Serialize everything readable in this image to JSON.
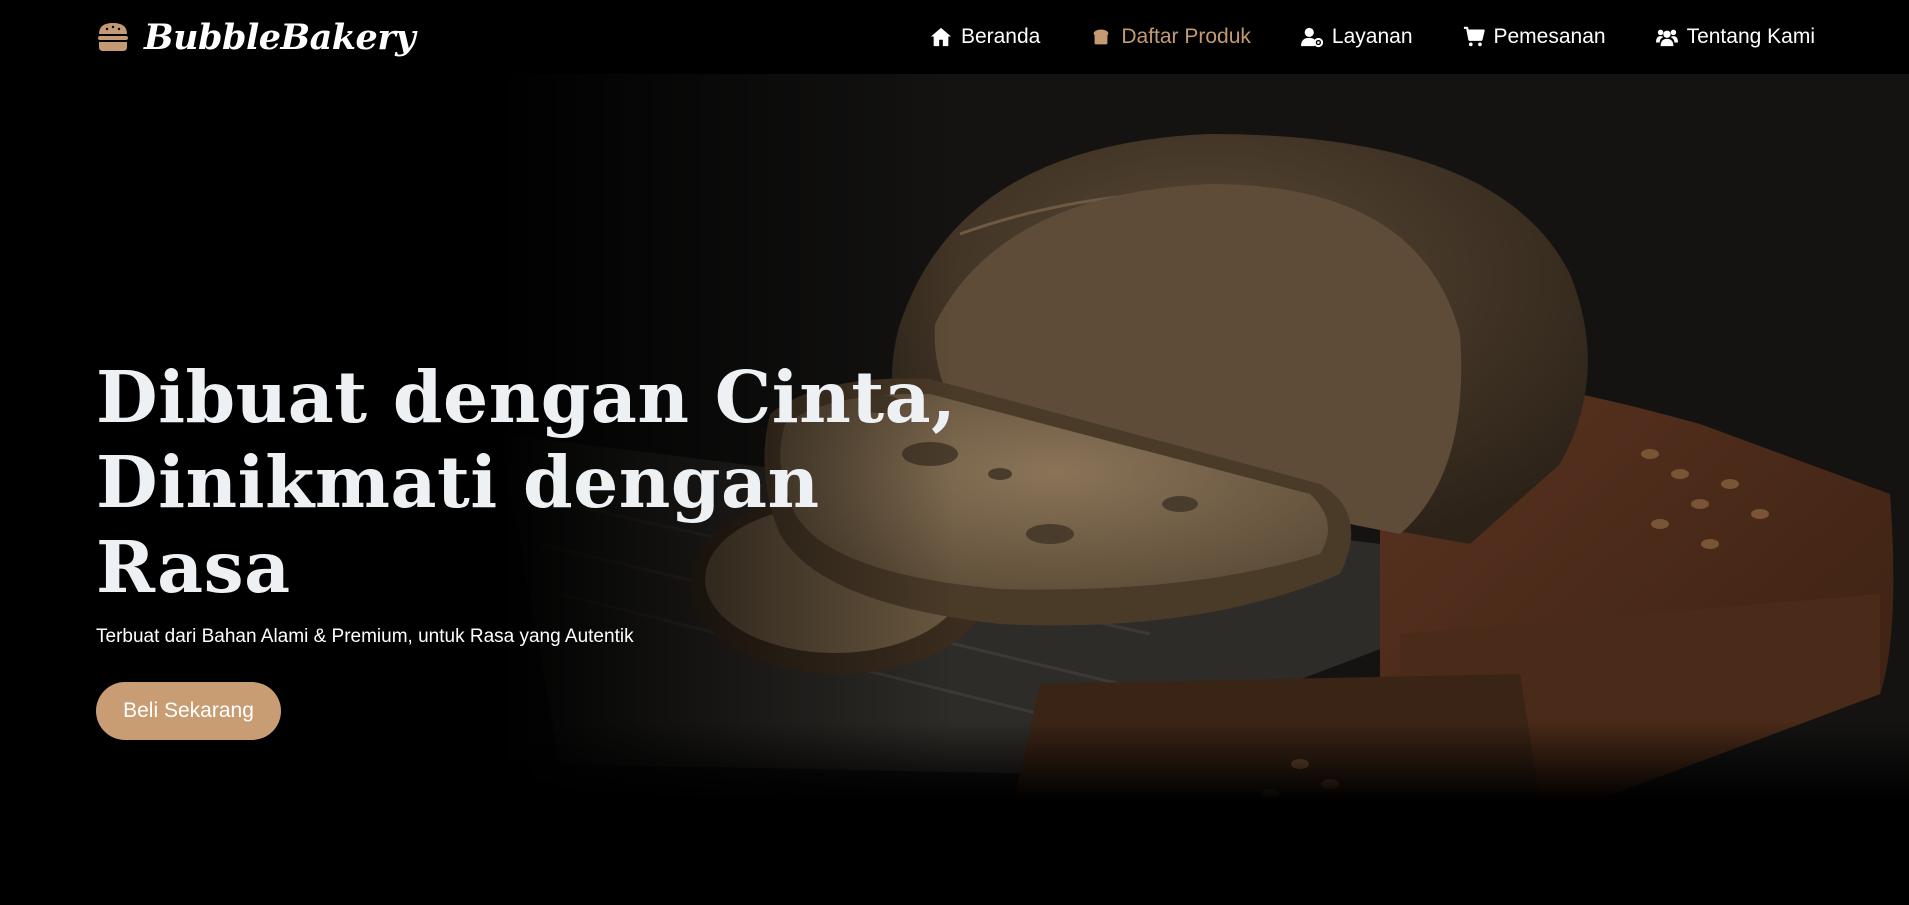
{
  "brand": {
    "name": "BubbleBakery",
    "icon": "burger-icon",
    "accent": "#c49a72"
  },
  "nav": {
    "items": [
      {
        "label": "Beranda",
        "icon": "home-icon",
        "active": false
      },
      {
        "label": "Daftar Produk",
        "icon": "bread-icon",
        "active": true
      },
      {
        "label": "Layanan",
        "icon": "user-gear-icon",
        "active": false
      },
      {
        "label": "Pemesanan",
        "icon": "cart-icon",
        "active": false
      },
      {
        "label": "Tentang Kami",
        "icon": "users-icon",
        "active": false
      }
    ]
  },
  "hero": {
    "title_lines": [
      "Dibuat dengan Cinta,",
      "Dinikmati dengan",
      "Rasa"
    ],
    "subtitle": "Terbuat dari Bahan Alami & Premium, untuk Rasa yang Autentik",
    "cta_label": "Beli Sekarang",
    "cta_color": "#c99d74",
    "background_image": "bread-photo"
  }
}
